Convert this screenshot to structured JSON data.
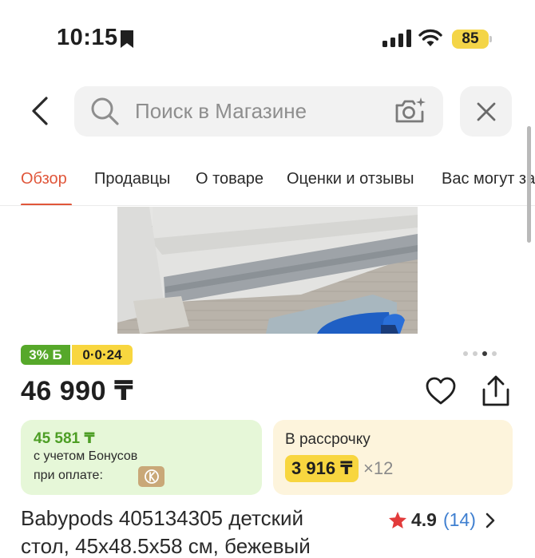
{
  "status_bar": {
    "time": "10:15",
    "battery": "85"
  },
  "search": {
    "placeholder": "Поиск в Магазине",
    "value": ""
  },
  "tabs": [
    {
      "label": "Обзор",
      "active": true
    },
    {
      "label": "Продавцы",
      "active": false
    },
    {
      "label": "О товаре",
      "active": false
    },
    {
      "label": "Оценки и отзывы",
      "active": false
    },
    {
      "label": "Вас могут за",
      "active": false
    }
  ],
  "gallery": {
    "dots_total": 4,
    "active_index": 2
  },
  "badges": {
    "cashback": "3% Б",
    "installment": "0·0·24"
  },
  "price": "46 990 ₸",
  "bonus_card": {
    "amount": "45 581 ₸",
    "line1": "с учетом Бонусов",
    "line2": "при оплате:"
  },
  "installment_card": {
    "label": "В рассрочку",
    "monthly": "3 916 ₸",
    "times": "×12"
  },
  "product": {
    "title_line1": "Babypods 405134305 детский",
    "title_line2": "стол, 45x48.5x58 см, бежевый"
  },
  "rating": {
    "value": "4.9",
    "count": "(14)"
  },
  "colors": {
    "accent": "#e0563a",
    "bonus_green": "#56a82a",
    "installment_yellow": "#f8d63f",
    "link_blue": "#3f7fd0"
  },
  "icons": [
    "bookmark-icon",
    "signal-icon",
    "wifi-icon",
    "back-icon",
    "search-icon",
    "camera-icon",
    "close-icon",
    "heart-icon",
    "share-icon",
    "star-icon",
    "chevron-right-icon"
  ]
}
